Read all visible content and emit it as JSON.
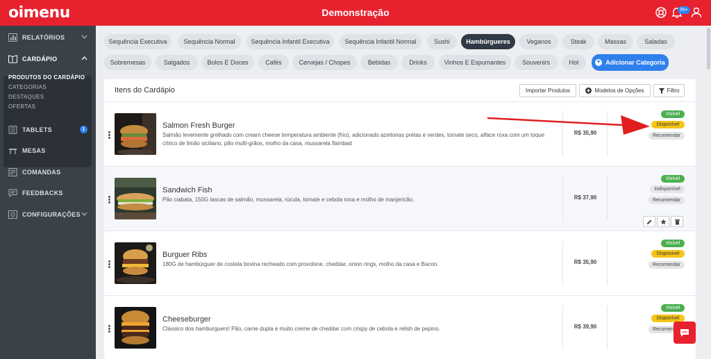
{
  "header": {
    "logo": "oimenu",
    "title": "Demonstração",
    "notifications_badge": "99+"
  },
  "sidebar": {
    "items": [
      {
        "label": "RELATÓRIOS"
      },
      {
        "label": "CARDÁPIO"
      },
      {
        "label": "TABLETS",
        "badge": "1"
      },
      {
        "label": "MESAS"
      },
      {
        "label": "COMANDAS"
      },
      {
        "label": "FEEDBACKS"
      },
      {
        "label": "CONFIGURAÇÕES"
      }
    ],
    "cardapio_sub": [
      "PRODUTOS DO CARDÁPIO",
      "CATEGORIAS",
      "DESTAQUES",
      "OFERTAS"
    ]
  },
  "categories": {
    "row1": [
      "Sequência Executiva",
      "Sequência Normal",
      "Sequência Infantil Executiva",
      "Sequência Infantil Normal",
      "Sushi",
      "Hambúrgueres",
      "Veganos",
      "Steak",
      "Massas",
      "Saladas"
    ],
    "row2": [
      "Sobremesas",
      "Salgados",
      "Bolos E Doces",
      "Cafés",
      "Cervejas / Chopes",
      "Bebidas",
      "Drinks",
      "Vinhos E Espumantes",
      "Souvenirs",
      "Hot"
    ],
    "add_label": "Adicionar Categoria",
    "active": "Hambúrgueres"
  },
  "panel": {
    "title": "Itens do Cardápio",
    "import_label": "Importar Produtos",
    "options_label": "Modelos de Opções",
    "filter_label": "Filtro"
  },
  "items": [
    {
      "name": "Salmon Fresh Burger",
      "description": "Salmão levemente grelhado com cream cheese temperatura ambiente (frio), adicionado azeitonas pretas e verdes, tomate seco, alface roxa com um toque cítrico de limão siciliano, pão multi-grãos, molho da casa, mussarela flambad",
      "price": "R$ 35,90",
      "visibility": "Visível",
      "availability": "Disponível",
      "recommend": "Recomendar"
    },
    {
      "name": "Sandwich Fish",
      "description": "Pão ciabata, 150G lascas de salmão, mussarela, rúcula, tomate e cebola roxa e molho de manjericão.",
      "price": "R$ 37,90",
      "visibility": "Visível",
      "availability": "Indisponível",
      "recommend": "Recomendar"
    },
    {
      "name": "Burguer Ribs",
      "description": "180G de hambúrguer de costela bovina recheado com provolone, cheddar, onion rings, molho da casa e Bacon.",
      "price": "R$ 35,90",
      "visibility": "Visível",
      "availability": "Disponível",
      "recommend": "Recomendar"
    },
    {
      "name": "Cheeseburger",
      "description": "Clássico dos hamburguers! Pão, carne dupla e muito creme de cheddar com crispy de cebola e relish de pepino.",
      "price": "R$ 39,90",
      "visibility": "Visível",
      "availability": "Disponível",
      "recommend": "Recomendar"
    }
  ],
  "colors": {
    "brand": "#e8212e",
    "sidebar": "#3a4249",
    "accent": "#2f80ed",
    "visible": "#4caf50",
    "available": "#f5c518"
  }
}
